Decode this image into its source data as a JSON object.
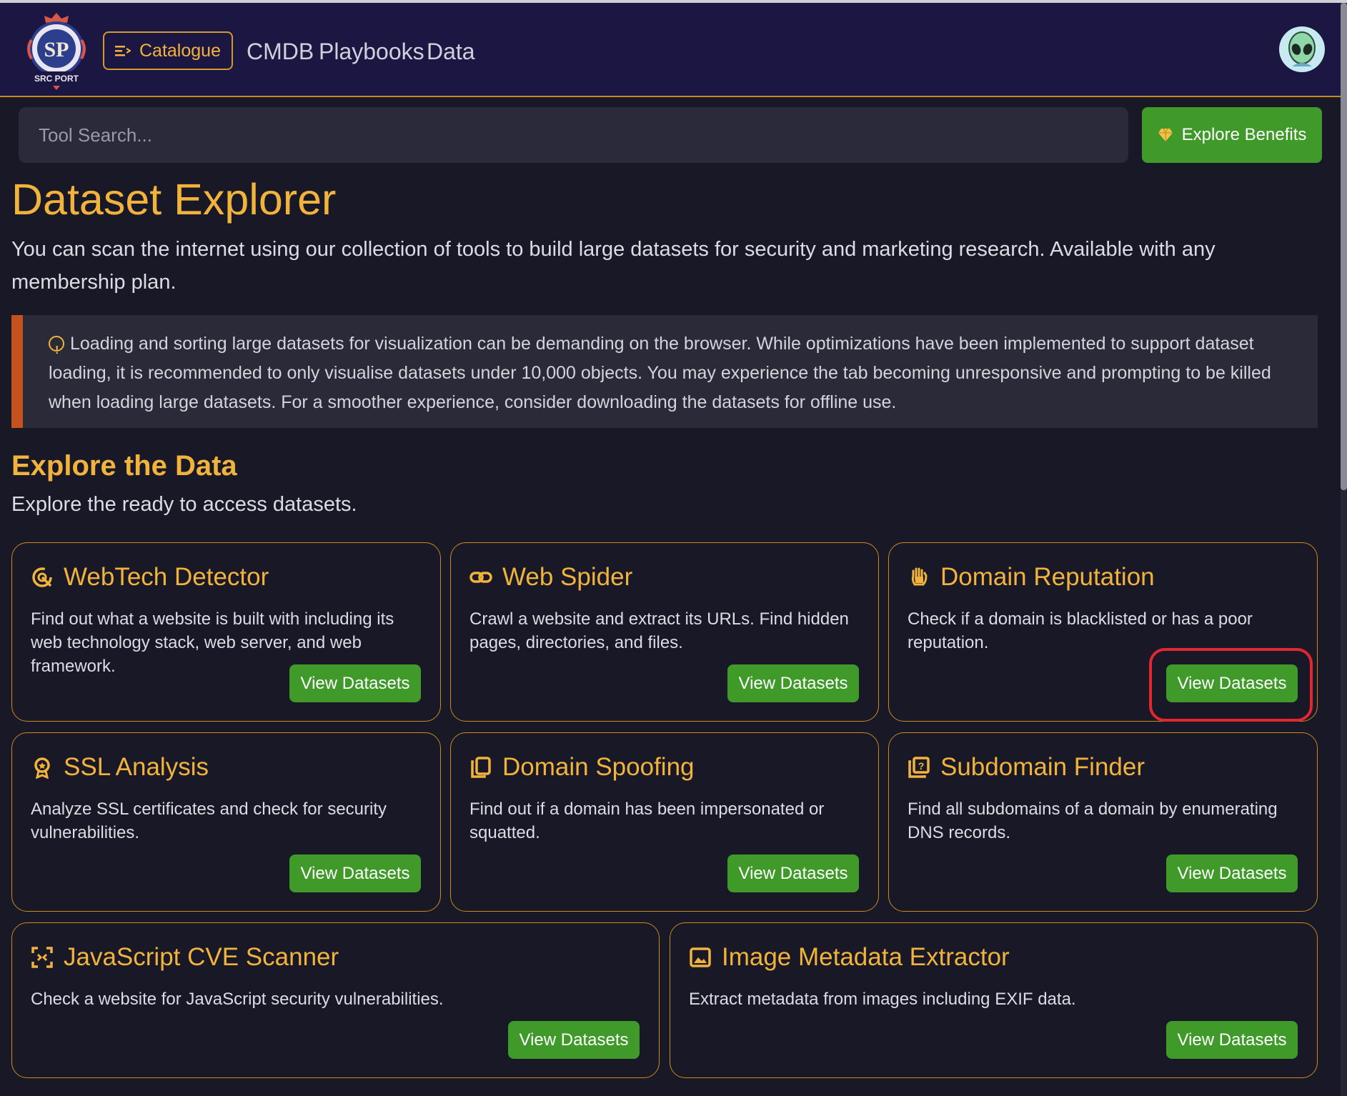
{
  "navbar": {
    "logo_text": "SRC PORT",
    "catalogue_label": "Catalogue",
    "links": [
      "CMDB",
      "Playbooks",
      "Data"
    ]
  },
  "search": {
    "placeholder": "Tool Search..."
  },
  "benefits_label": "Explore Benefits",
  "page": {
    "title": "Dataset Explorer",
    "intro": "You can scan the internet using our collection of tools to build large datasets for security and marketing research. Available with any membership plan.",
    "warning": "Loading and sorting large datasets for visualization can be demanding on the browser. While optimizations have been implemented to support dataset loading, it is recommended to only visualise datasets under 10,000 objects. You may experience the tab becoming unresponsive and prompting to be killed when loading large datasets. For a smoother experience, consider downloading the datasets for offline use.",
    "section_title": "Explore the Data",
    "section_sub": "Explore the ready to access datasets."
  },
  "cards": [
    {
      "title": "WebTech Detector",
      "desc": "Find out what a website is built with including its web technology stack, web server, and web framework.",
      "button": "View Datasets",
      "icon": "radar-icon"
    },
    {
      "title": "Web Spider",
      "desc": "Crawl a website and extract its URLs. Find hidden pages, directories, and files.",
      "button": "View Datasets",
      "icon": "link-icon"
    },
    {
      "title": "Domain Reputation",
      "desc": "Check if a domain is blacklisted or has a poor reputation.",
      "button": "View Datasets",
      "icon": "hand-icon"
    },
    {
      "title": "SSL Analysis",
      "desc": "Analyze SSL certificates and check for security vulnerabilities.",
      "button": "View Datasets",
      "icon": "award-icon"
    },
    {
      "title": "Domain Spoofing",
      "desc": "Find out if a domain has been impersonated or squatted.",
      "button": "View Datasets",
      "icon": "copy-icon"
    },
    {
      "title": "Subdomain Finder",
      "desc": "Find all subdomains of a domain by enumerating DNS records.",
      "button": "View Datasets",
      "icon": "question-box-icon"
    },
    {
      "title": "JavaScript CVE Scanner",
      "desc": "Check a website for JavaScript security vulnerabilities.",
      "button": "View Datasets",
      "icon": "scan-icon"
    },
    {
      "title": "Image Metadata Extractor",
      "desc": "Extract metadata from images including EXIF data.",
      "button": "View Datasets",
      "icon": "image-icon"
    }
  ],
  "colors": {
    "accent": "#f2b33c",
    "button_green": "#3f9a2a",
    "highlight_red": "#e3262f",
    "navbar_bg": "#1c1742",
    "page_bg": "#181826"
  }
}
